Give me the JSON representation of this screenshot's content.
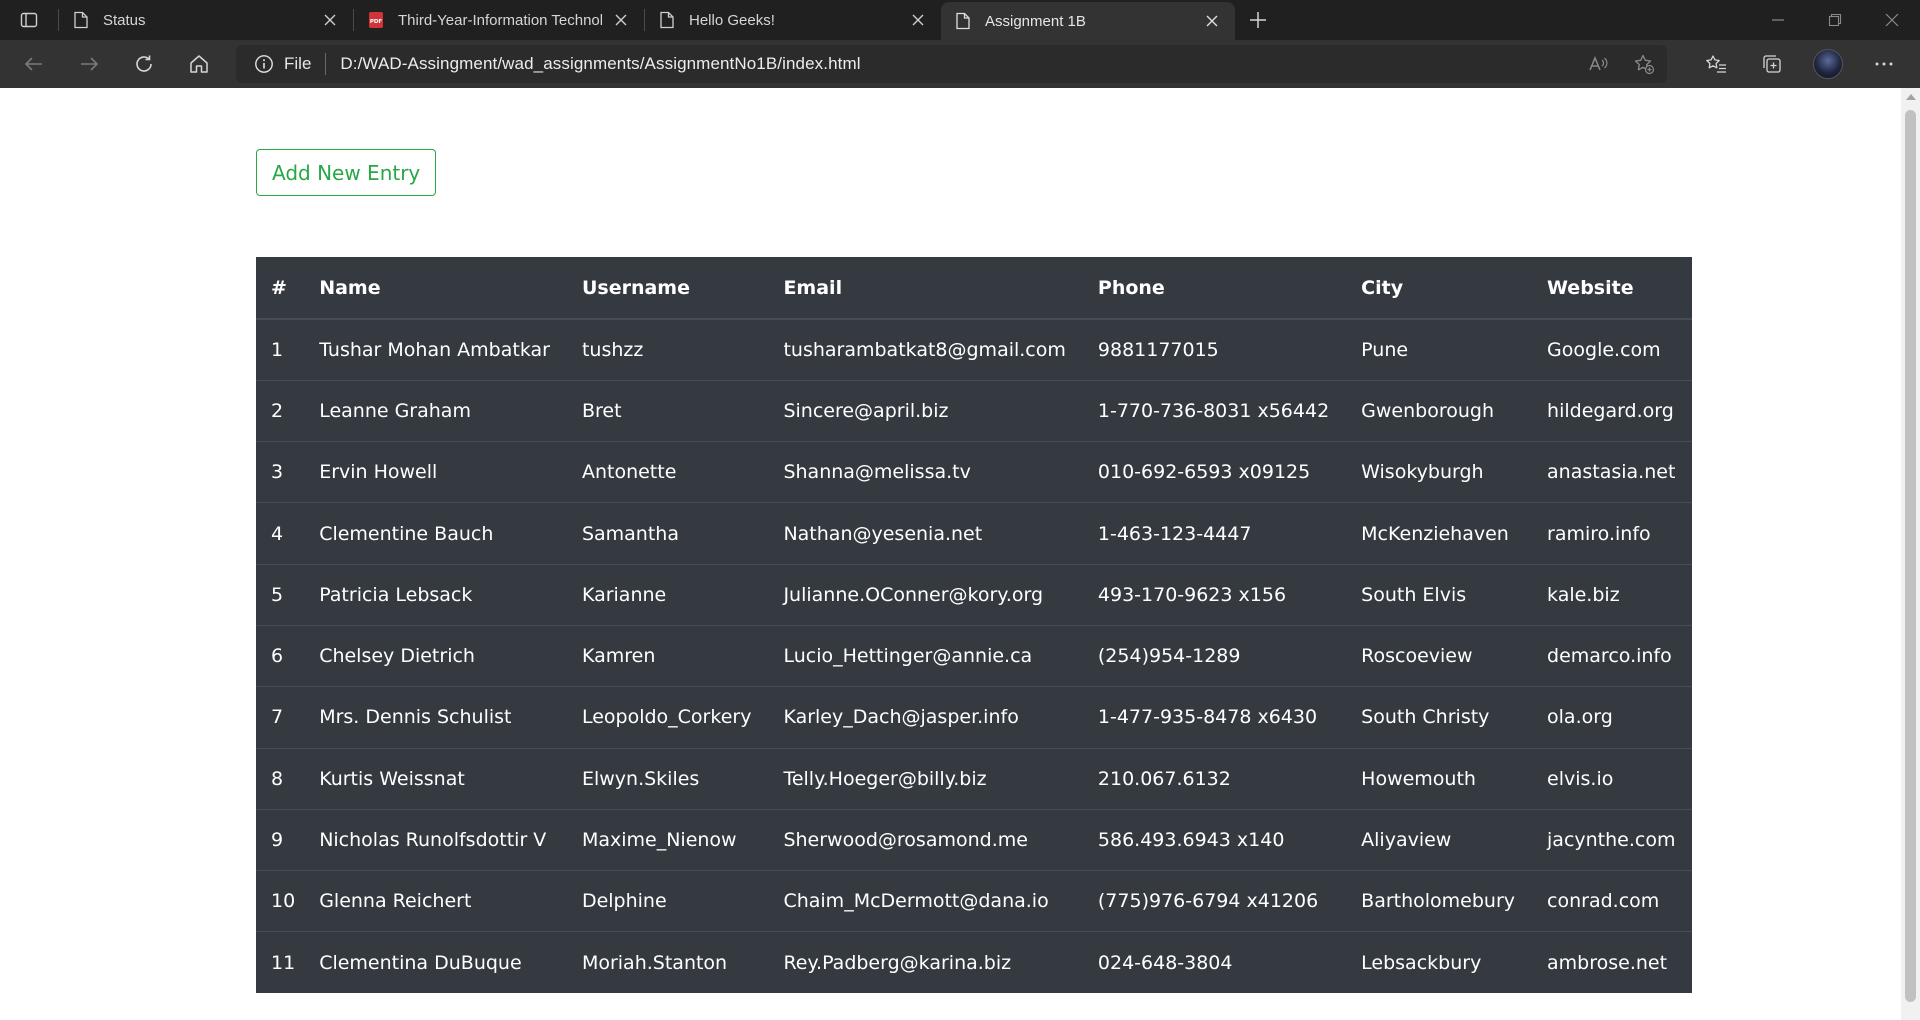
{
  "browser": {
    "tabs": [
      {
        "title": "Status",
        "icon": "page-icon",
        "active": false
      },
      {
        "title": "Third-Year-Information Technolo",
        "icon": "pdf-icon",
        "active": false
      },
      {
        "title": "Hello Geeks!",
        "icon": "page-icon",
        "active": false
      },
      {
        "title": "Assignment 1B",
        "icon": "page-icon",
        "active": true
      }
    ],
    "address": {
      "scheme_label": "File",
      "url": "D:/WAD-Assingment/wad_assignments/AssignmentNo1B/index.html"
    }
  },
  "page": {
    "add_button_label": "Add New Entry",
    "table": {
      "headers": [
        "#",
        "Name",
        "Username",
        "Email",
        "Phone",
        "City",
        "Website"
      ],
      "rows": [
        [
          "1",
          "Tushar Mohan Ambatkar",
          "tushzz",
          "tusharambatkat8@gmail.com",
          "9881177015",
          "Pune",
          "Google.com"
        ],
        [
          "2",
          "Leanne Graham",
          "Bret",
          "Sincere@april.biz",
          "1-770-736-8031 x56442",
          "Gwenborough",
          "hildegard.org"
        ],
        [
          "3",
          "Ervin Howell",
          "Antonette",
          "Shanna@melissa.tv",
          "010-692-6593 x09125",
          "Wisokyburgh",
          "anastasia.net"
        ],
        [
          "4",
          "Clementine Bauch",
          "Samantha",
          "Nathan@yesenia.net",
          "1-463-123-4447",
          "McKenziehaven",
          "ramiro.info"
        ],
        [
          "5",
          "Patricia Lebsack",
          "Karianne",
          "Julianne.OConner@kory.org",
          "493-170-9623 x156",
          "South Elvis",
          "kale.biz"
        ],
        [
          "6",
          "Chelsey Dietrich",
          "Kamren",
          "Lucio_Hettinger@annie.ca",
          "(254)954-1289",
          "Roscoeview",
          "demarco.info"
        ],
        [
          "7",
          "Mrs. Dennis Schulist",
          "Leopoldo_Corkery",
          "Karley_Dach@jasper.info",
          "1-477-935-8478 x6430",
          "South Christy",
          "ola.org"
        ],
        [
          "8",
          "Kurtis Weissnat",
          "Elwyn.Skiles",
          "Telly.Hoeger@billy.biz",
          "210.067.6132",
          "Howemouth",
          "elvis.io"
        ],
        [
          "9",
          "Nicholas Runolfsdottir V",
          "Maxime_Nienow",
          "Sherwood@rosamond.me",
          "586.493.6943 x140",
          "Aliyaview",
          "jacynthe.com"
        ],
        [
          "10",
          "Glenna Reichert",
          "Delphine",
          "Chaim_McDermott@dana.io",
          "(775)976-6794 x41206",
          "Bartholomebury",
          "conrad.com"
        ],
        [
          "11",
          "Clementina DuBuque",
          "Moriah.Stanton",
          "Rey.Padberg@karina.biz",
          "024-648-3804",
          "Lebsackbury",
          "ambrose.net"
        ]
      ]
    }
  },
  "colors": {
    "chrome_dark": "#202020",
    "toolbar": "#333333",
    "success_green": "#28a745",
    "table_dark": "#343a40"
  }
}
